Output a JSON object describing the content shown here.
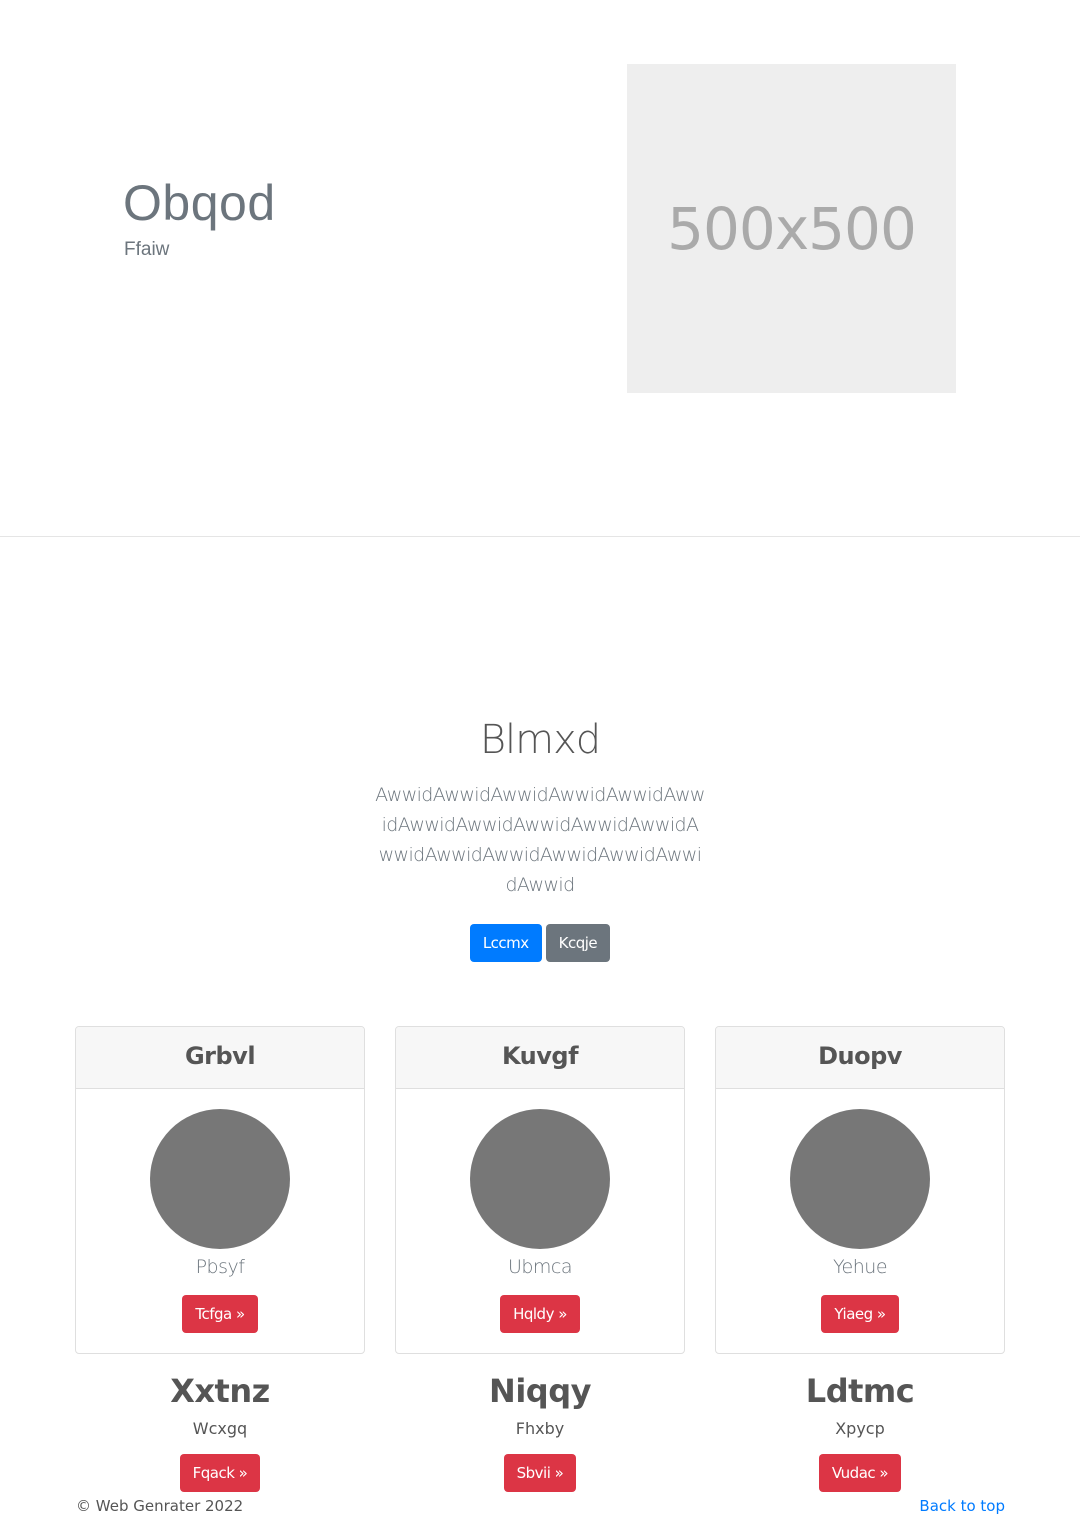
{
  "hero": {
    "title": "Obqod",
    "subtitle": "Ffaiw",
    "image_placeholder": "500x500"
  },
  "intro": {
    "title": "Blmxd",
    "text": "AwwidAwwidAwwidAwwidAwwidAwwidAwwidAwwidAwwidAwwidAwwidAwwidAwwidAwwidAwwidAwwidAwwidAwwid",
    "primary_button": "Lccmx",
    "secondary_button": "Kcqje"
  },
  "cards": [
    {
      "header": "Grbvl",
      "caption": "Pbsyf",
      "button": "Tcfga »"
    },
    {
      "header": "Kuvgf",
      "caption": "Ubmca",
      "button": "Hqldy »"
    },
    {
      "header": "Duopv",
      "caption": "Yehue",
      "button": "Yiaeg »"
    }
  ],
  "features": [
    {
      "title": "Xxtnz",
      "text": "Wcxgq",
      "button": "Fqack »"
    },
    {
      "title": "Niqqy",
      "text": "Fhxby",
      "button": "Sbvii »"
    },
    {
      "title": "Ldtmc",
      "text": "Xpycp",
      "button": "Vudac »"
    }
  ],
  "footer": {
    "copyright": "© Web Genrater 2022",
    "back_to_top": "Back to top"
  },
  "colors": {
    "primary": "#007bff",
    "secondary": "#6c757d",
    "danger": "#dc3545",
    "placeholder_bg": "#eeeeee",
    "avatar": "#777777"
  }
}
